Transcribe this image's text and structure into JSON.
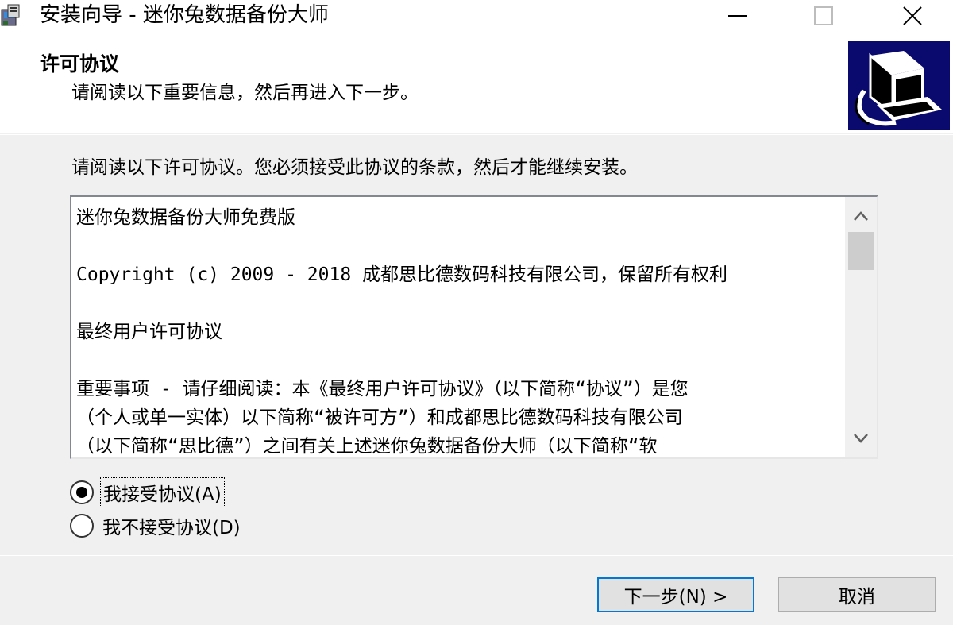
{
  "window": {
    "title": "安装向导 - 迷你兔数据备份大师",
    "icons": {
      "app": "installer-app-icon",
      "minimize": "minimize-icon",
      "maximize": "maximize-icon",
      "close": "close-icon"
    }
  },
  "header": {
    "title": "许可协议",
    "subtitle": "请阅读以下重要信息，然后再进入下一步。",
    "image": "computer-backup-icon"
  },
  "instruction": "请阅读以下许可协议。您必须接受此协议的条款，然后才能继续安装。",
  "license": {
    "line1": "迷你兔数据备份大师免费版",
    "line2": "Copyright (c) 2009 - 2018 成都思比德数码科技有限公司，保留所有权利",
    "line3": "最终用户许可协议",
    "line4": "重要事项 - 请仔细阅读：本《最终用户许可协议》（以下简称“协议”）是您",
    "line5": "（个人或单一实体）以下简称“被许可方”）和成都思比德数码科技有限公司",
    "line6": "（以下简称“思比德”）之间有关上述迷你兔数据备份大师（以下简称“软"
  },
  "options": {
    "accept": {
      "label": "我接受协议(A)",
      "selected": true
    },
    "decline": {
      "label": "我不接受协议(D)",
      "selected": false
    }
  },
  "buttons": {
    "next": "下一步(N) >",
    "cancel": "取消"
  },
  "colors": {
    "accent": "#0078d7",
    "header_image_bg": "#0a0a6e"
  }
}
